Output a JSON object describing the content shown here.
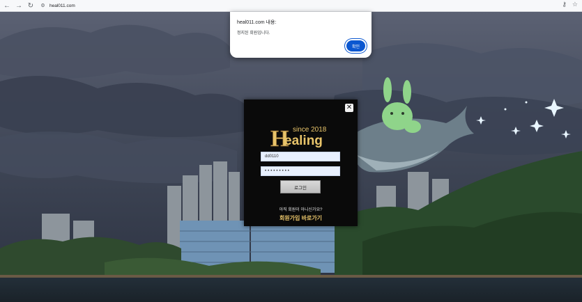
{
  "browser": {
    "url": "heal011.com",
    "back_icon": "arrow-left-icon",
    "forward_icon": "arrow-right-icon",
    "reload_icon": "reload-icon",
    "site_info_icon": "site-settings-icon",
    "password_icon": "key-icon",
    "bookmark_icon": "star-icon"
  },
  "alert": {
    "title": "heal011.com 내용:",
    "message": "정지된 회원입니다.",
    "ok_label": "확인",
    "accent": "#0b57d0"
  },
  "login": {
    "logo_since": "since 2018",
    "logo_brand": "ealing",
    "logo_initial": "H",
    "username_value": "dd0110",
    "password_value": "•••••••••",
    "login_label": "로그인",
    "signup_question": "아직 회원이 아니신가요?",
    "signup_link": "회원가입 바로가기",
    "accent": "#e8c46a"
  }
}
